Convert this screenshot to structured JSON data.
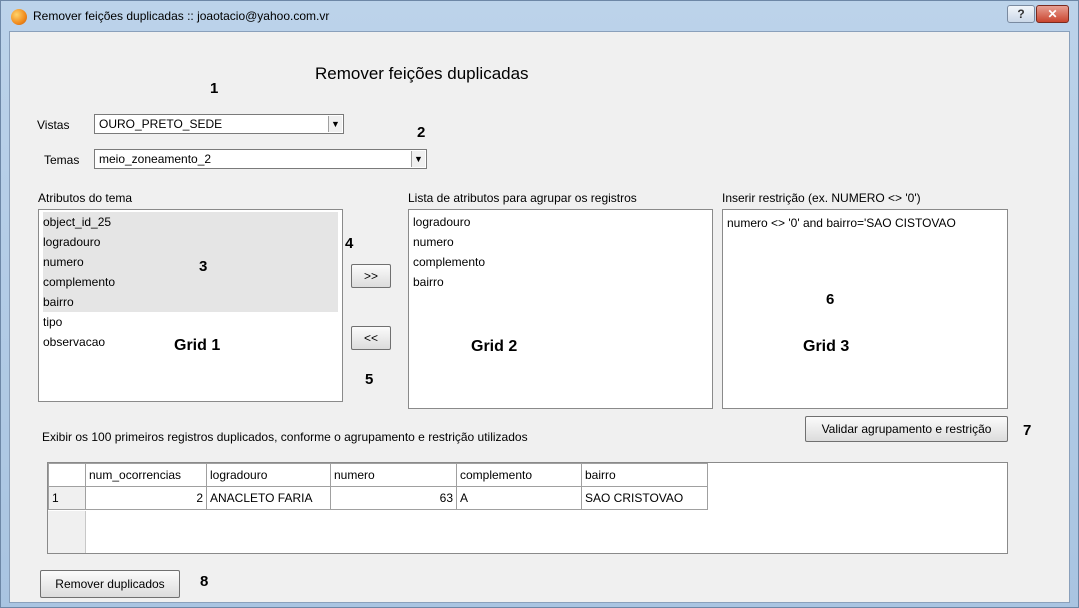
{
  "window": {
    "title": "Remover feições duplicadas :: joaotacio@yahoo.com.vr",
    "help": "?",
    "close": "✕"
  },
  "heading": "Remover feições duplicadas",
  "markers": [
    "1",
    "2",
    "3",
    "4",
    "5",
    "6",
    "7",
    "8"
  ],
  "vistas": {
    "label": "Vistas",
    "value": "OURO_PRETO_SEDE"
  },
  "temas": {
    "label": "Temas",
    "value": "meio_zoneamento_2"
  },
  "attrs": {
    "label": "Atributos do tema",
    "items": [
      "object_id_25",
      "logradouro",
      "numero",
      "complemento",
      "bairro",
      "tipo",
      "observacao"
    ],
    "grid_label": "Grid 1"
  },
  "group": {
    "label": "Lista de atributos para agrupar os registros",
    "items": [
      "logradouro",
      "numero",
      "complemento",
      "bairro"
    ],
    "grid_label": "Grid 2"
  },
  "restr": {
    "label": "Inserir restrição (ex. NUMERO <> '0')",
    "value": "numero <> '0' and bairro='SAO CISTOVAO",
    "grid_label": "Grid 3"
  },
  "buttons": {
    "add": ">>",
    "remove": "<<",
    "validate": "Validar agrupamento e restrição",
    "remove_dups": "Remover duplicados"
  },
  "info": "Exibir os 100 primeiros registros duplicados, conforme o agrupamento e restrição utilizados",
  "table": {
    "columns": [
      "num_ocorrencias",
      "logradouro",
      "numero",
      "complemento",
      "bairro"
    ],
    "rows": [
      {
        "n": "1",
        "cells": [
          "2",
          "ANACLETO FARIA",
          "63",
          "A",
          "SAO CRISTOVAO"
        ]
      }
    ]
  },
  "colors": {
    "titlebar": "#bcd3ea",
    "client": "#f0f0f0"
  }
}
